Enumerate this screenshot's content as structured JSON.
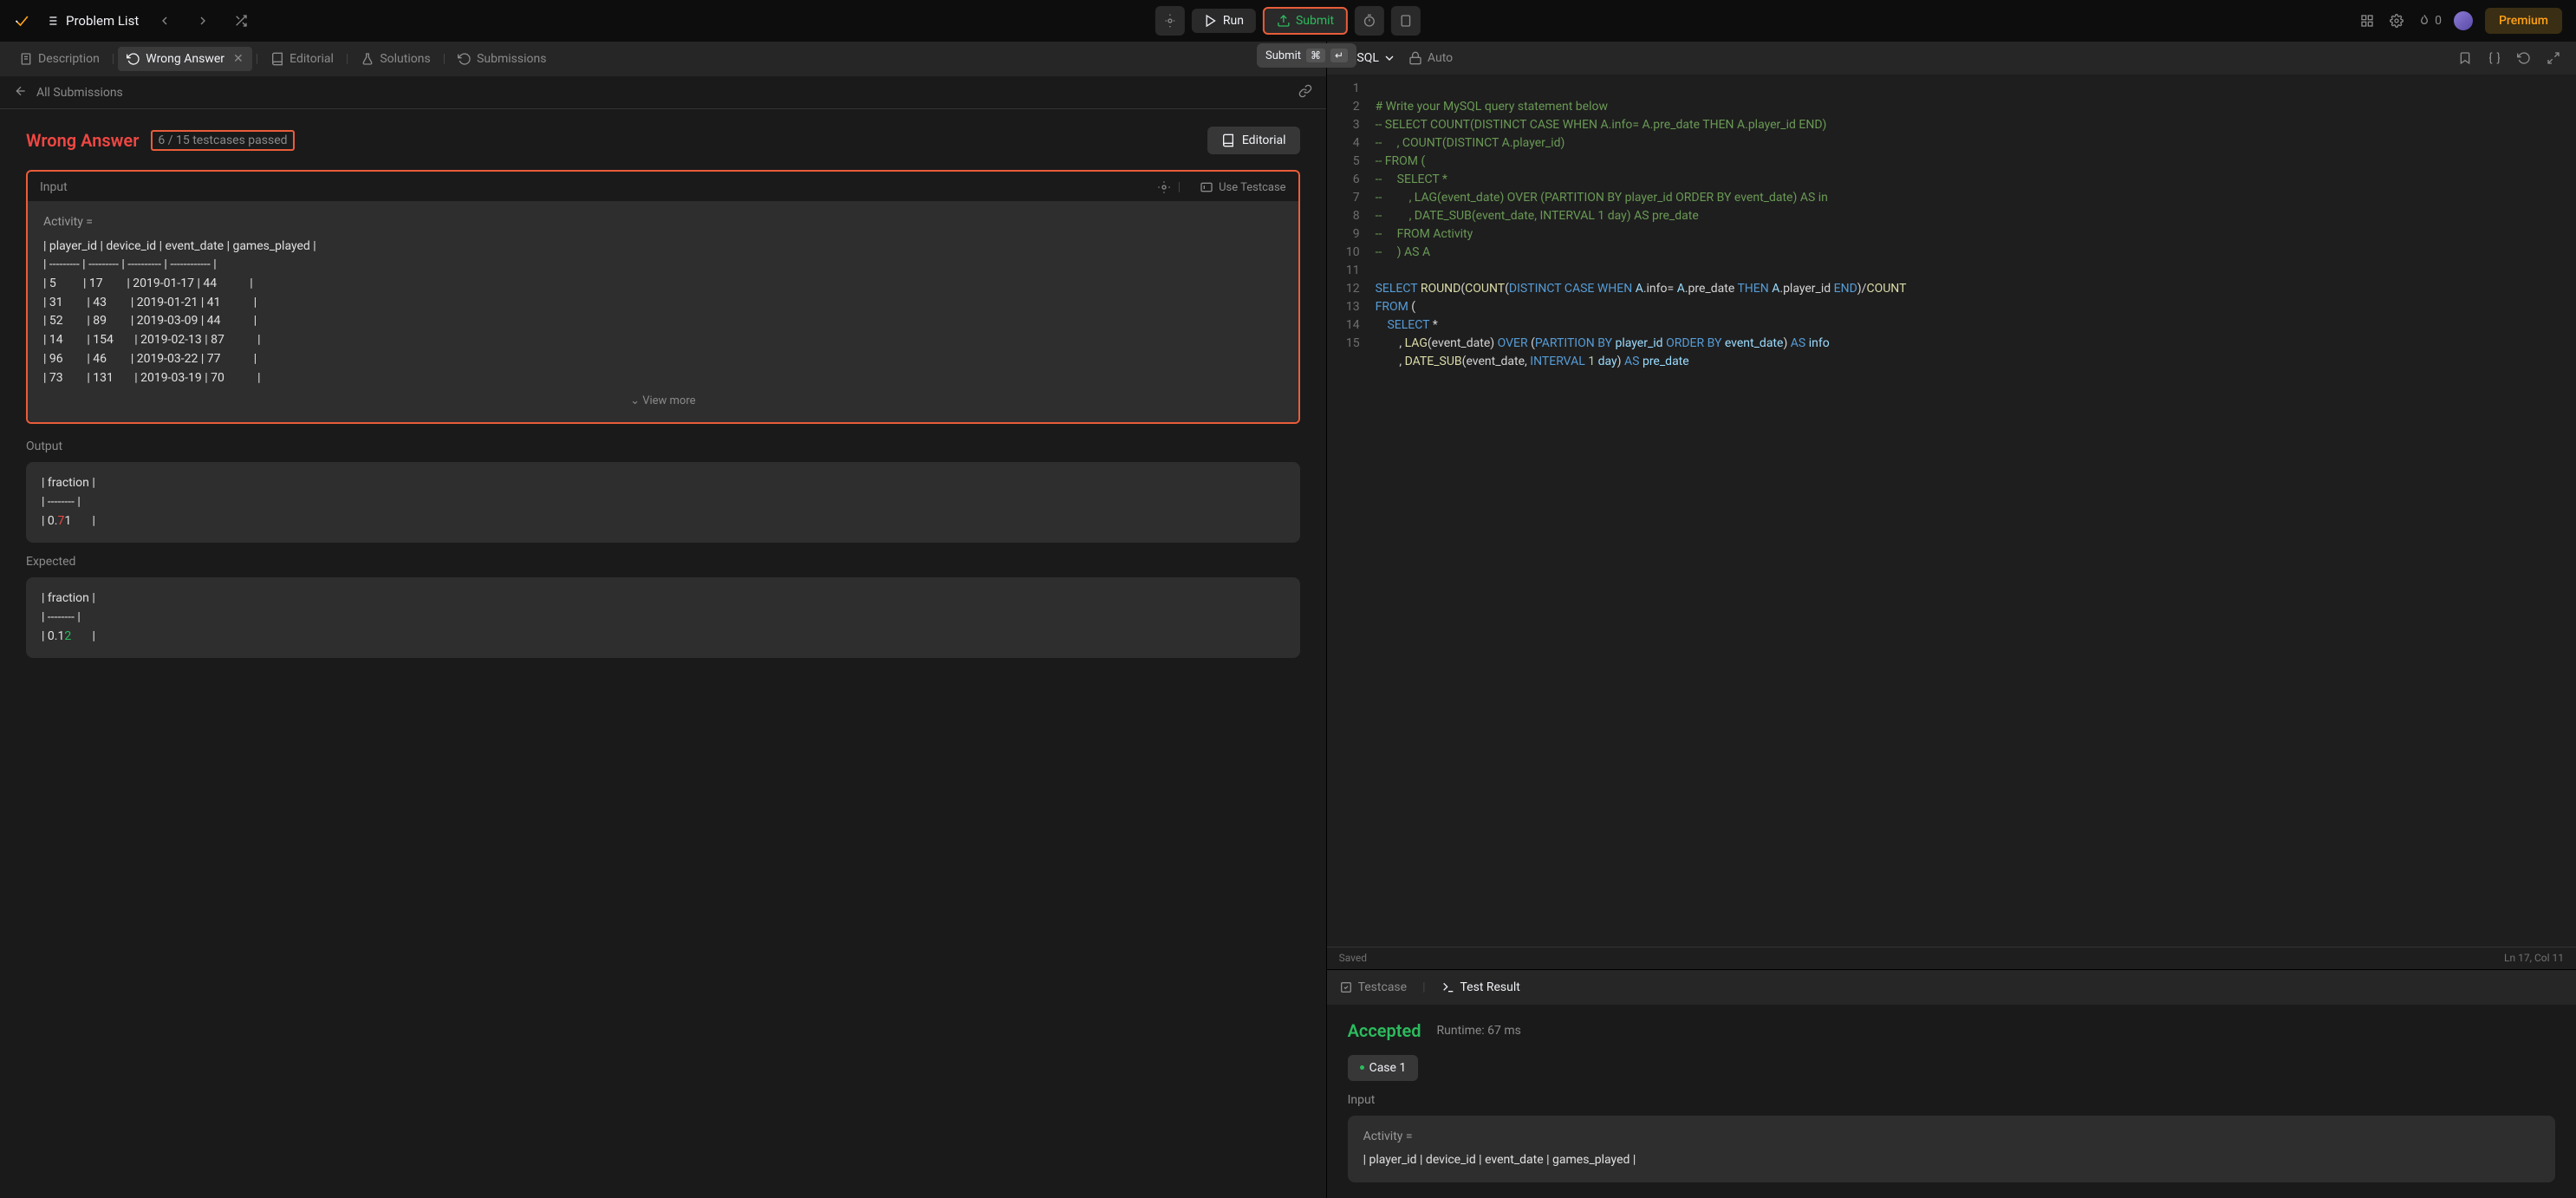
{
  "topbar": {
    "problem_list": "Problem List",
    "run": "Run",
    "submit": "Submit",
    "fire_count": "0",
    "premium": "Premium"
  },
  "tooltip": {
    "label": "Submit",
    "key1": "⌘",
    "key2": "↵"
  },
  "tabs": {
    "description": "Description",
    "wrong_answer": "Wrong Answer",
    "editorial": "Editorial",
    "solutions": "Solutions",
    "submissions": "Submissions"
  },
  "sub_header": {
    "all_submissions": "All Submissions"
  },
  "result": {
    "status": "Wrong Answer",
    "passed": "6 / 15 testcases passed",
    "editorial_btn": "Editorial",
    "input_label": "Input",
    "use_testcase": "Use Testcase",
    "activity_label": "Activity =",
    "input_table": "| player_id | device_id | event_date | games_played |\n| --------- | --------- | ---------- | ------------ |\n| 5         | 17        | 2019-01-17 | 44           |\n| 31        | 43        | 2019-01-21 | 41           |\n| 52        | 89        | 2019-03-09 | 44           |\n| 14        | 154       | 2019-02-13 | 87           |\n| 96        | 46        | 2019-03-22 | 77           |\n| 73        | 131       | 2019-03-19 | 70           |",
    "view_more": "View more",
    "output_label": "Output",
    "output_pre": "| fraction |\n| -------- |\n| 0.",
    "output_diff": "7",
    "output_post": "1       |",
    "expected_label": "Expected",
    "expected_pre": "| fraction |\n| -------- |\n| 0.1",
    "expected_diff": "2",
    "expected_post": "       |"
  },
  "editor": {
    "language": "MySQL",
    "auto": "Auto",
    "saved": "Saved",
    "cursor": "Ln 17, Col 11",
    "lines": {
      "l1": "# Write your MySQL query statement below",
      "l2": "-- SELECT COUNT(DISTINCT CASE WHEN A.info= A.pre_date THEN A.player_id END)",
      "l3": "--     , COUNT(DISTINCT A.player_id)",
      "l4": "-- FROM (",
      "l5": "--     SELECT *",
      "l6": "--         , LAG(event_date) OVER (PARTITION BY player_id ORDER BY event_date) AS in",
      "l7": "--         , DATE_SUB(event_date, INTERVAL 1 day) AS pre_date",
      "l8": "--     FROM Activity",
      "l9": "--     ) AS A"
    }
  },
  "test_result": {
    "testcase_tab": "Testcase",
    "result_tab": "Test Result",
    "accepted": "Accepted",
    "runtime": "Runtime: 67 ms",
    "case1": "Case 1",
    "input_label": "Input",
    "activity_label": "Activity =",
    "input_row": "| player_id | device_id | event_date | games_played |"
  }
}
